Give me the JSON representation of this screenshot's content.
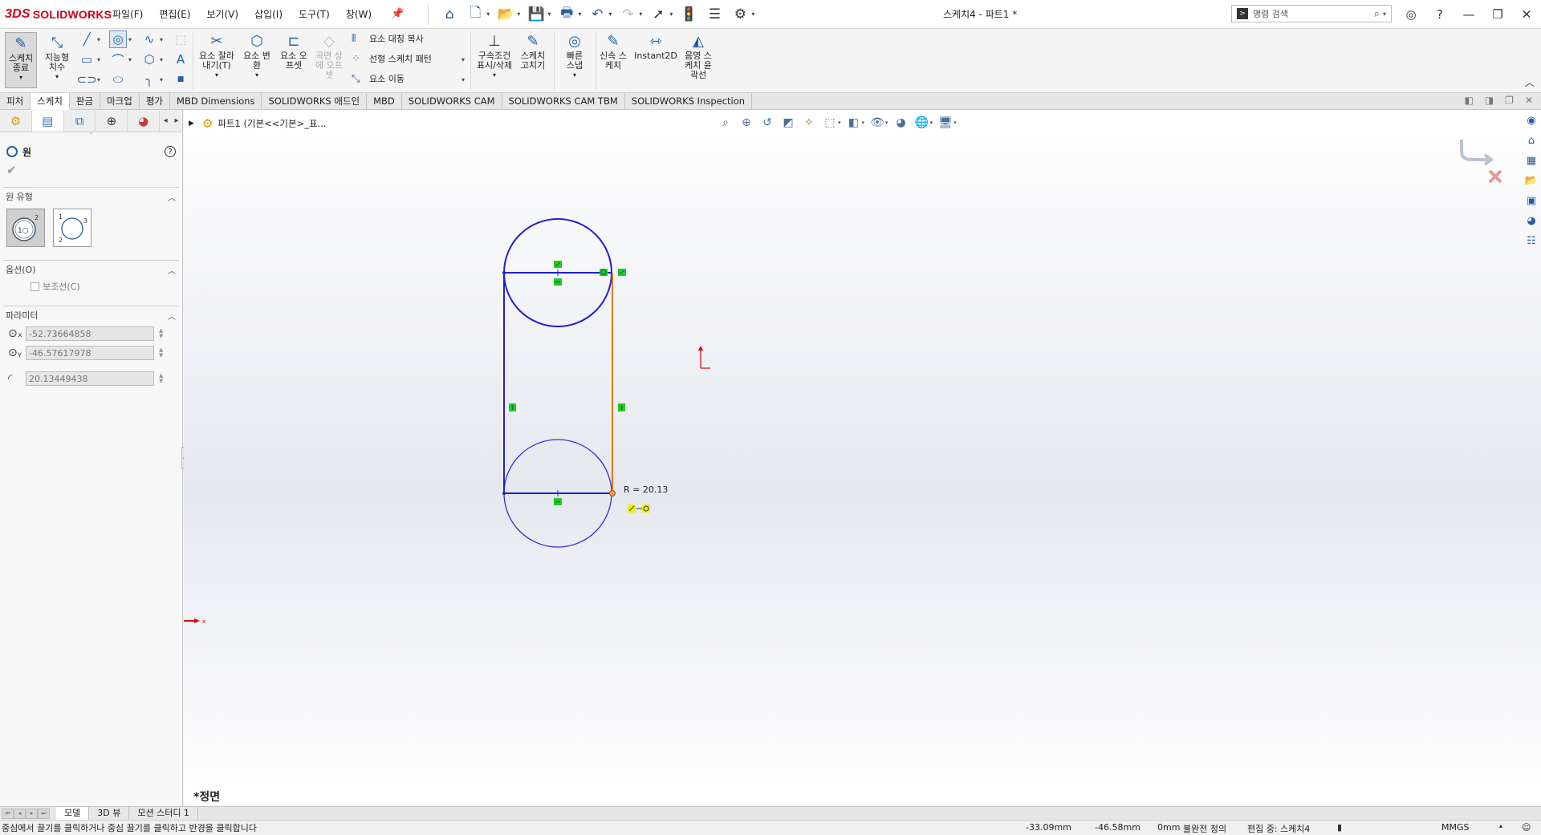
{
  "app": {
    "brand": "SOLIDWORKS",
    "brand_prefix": "3DS",
    "doc_title": "스케치4 - 파트1 *"
  },
  "menus": [
    "파일(F)",
    "편집(E)",
    "보기(V)",
    "삽입(I)",
    "도구(T)",
    "창(W)"
  ],
  "search": {
    "placeholder": "명령 검색"
  },
  "ribbon": {
    "exit_sketch": "스케치 종료",
    "smart_dim": "지능형 치수",
    "trim": "요소 잘라내기(T)",
    "convert": "요소 변환",
    "offset": "요소 오프셋",
    "offset_surface": "곡면 상에 오프셋",
    "mirror": "요소 대칭 복사",
    "linear_pattern": "선형 스케치 패턴",
    "move": "요소 이동",
    "relations": "구속조건 표시/삭제",
    "repair": "스케치 고치기",
    "quick_snaps": "빠른 스냅",
    "rapid": "신속 스케치",
    "instant2d": "Instant2D",
    "shaded": "음영 스케치 윤곽선"
  },
  "tabs": [
    "피처",
    "스케치",
    "판금",
    "마크업",
    "평가",
    "MBD Dimensions",
    "SOLIDWORKS 애드인",
    "MBD",
    "SOLIDWORKS CAM",
    "SOLIDWORKS CAM TBM",
    "SOLIDWORKS Inspection"
  ],
  "active_tab": "스케치",
  "pm": {
    "title": "원",
    "help": "?",
    "group_type": "원 유형",
    "group_options": "옵션(O)",
    "construction": "보조선(C)",
    "group_params": "파라미터",
    "cx": "-52.73664858",
    "cy": "-46.57617978",
    "radius": "20.13449438",
    "center_btn": "1○",
    "perimeter_btn": "1 2 3"
  },
  "gfx": {
    "crumb": "파트1  (기본<<기본>_표...",
    "view_name": "*정면",
    "radius_label": "R = 20.13",
    "axis_x": "x",
    "axis_y": "y"
  },
  "modeltabs": [
    "모델",
    "3D 뷰",
    "모션 스터디 1"
  ],
  "status": {
    "message": "중심에서 끌기를 클릭하거나 중심 끌기를 클릭하고 반경을 클릭합니다",
    "x": "-33.09mm",
    "y": "-46.58mm",
    "z": "0mm",
    "define": "불완전 정의",
    "editing": "편집 중: 스케치4",
    "units": "MMGS"
  },
  "colors": {
    "sketch_blue": "#2020d0",
    "accent_orange": "#e07a10",
    "relation_green": "#22cc22",
    "brand_red": "#d0021b"
  }
}
